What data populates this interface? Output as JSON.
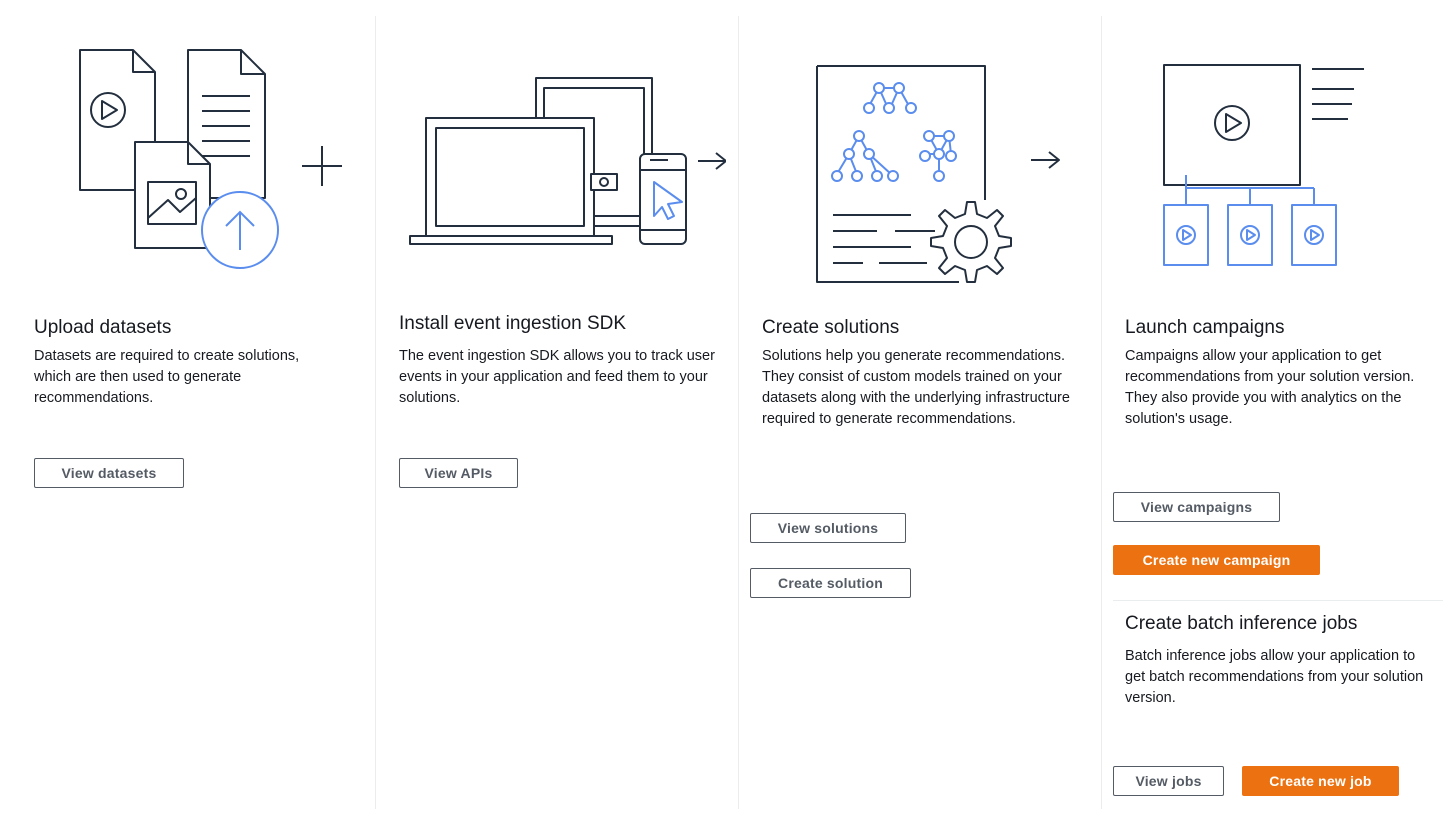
{
  "steps": [
    {
      "title": "Upload datasets",
      "description": "Datasets are required to create solutions, which are then used to generate recommendations.",
      "buttons": [
        "View datasets"
      ]
    },
    {
      "title": "Install event ingestion SDK",
      "description": "The event ingestion SDK allows you to track user events in your application and feed them to your solutions.",
      "buttons": [
        "View APIs"
      ]
    },
    {
      "title": "Create solutions",
      "description": "Solutions help you generate recommendations. They consist of custom models trained on your datasets along with the underlying infrastructure required to generate recommendations.",
      "buttons": [
        "View solutions",
        "Create solution"
      ]
    },
    {
      "title": "Launch campaigns",
      "description": "Campaigns allow your application to get recommendations from your solution version. They also provide you with analytics on the solution's usage.",
      "buttons": [
        "View campaigns",
        "Create new campaign"
      ]
    }
  ],
  "batch": {
    "title": "Create batch inference jobs",
    "description": "Batch inference jobs allow your application to get batch recommendations from your solution version.",
    "buttons": [
      "View jobs",
      "Create new job"
    ]
  },
  "colors": {
    "accent": "#ec7211",
    "illustration_blue": "#5a8dee",
    "illustration_dark": "#232f3e"
  },
  "icons": [
    "files-upload-illustration",
    "plus-icon",
    "laptop-phone-illustration",
    "arrow-right-icon",
    "model-gear-illustration",
    "video-tree-illustration"
  ]
}
